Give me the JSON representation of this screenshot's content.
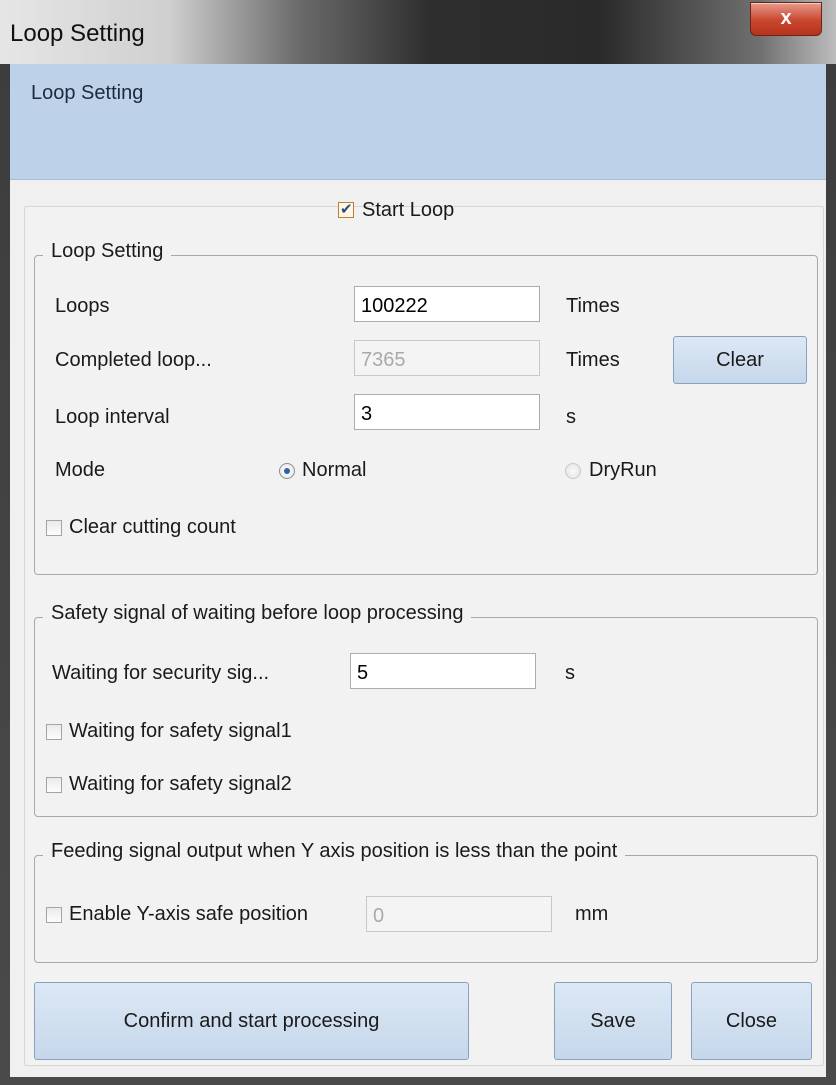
{
  "window": {
    "title": "Loop Setting",
    "close_glyph": "x"
  },
  "header": {
    "title": "Loop Setting"
  },
  "start_loop": {
    "label": "Start Loop",
    "checked": true
  },
  "loop_group": {
    "legend": "Loop Setting",
    "loops_label": "Loops",
    "loops_value": "100222",
    "loops_unit": "Times",
    "completed_label": "Completed  loop...",
    "completed_value": "7365",
    "completed_unit": "Times",
    "clear_button": "Clear",
    "interval_label": "Loop interval",
    "interval_value": "3",
    "interval_unit": "s",
    "mode_label": "Mode",
    "mode_normal": "Normal",
    "mode_dryrun": "DryRun",
    "mode_selected": "Normal",
    "clear_cutting_label": "Clear cutting count",
    "clear_cutting_checked": false
  },
  "safety_group": {
    "legend": "Safety signal of waiting before loop processing",
    "wait_label": "Waiting  for security sig...",
    "wait_value": "5",
    "wait_unit": "s",
    "signal1_label": "Waiting for safety signal1",
    "signal1_checked": false,
    "signal2_label": "Waiting for safety signal2",
    "signal2_checked": false
  },
  "feeding_group": {
    "legend": "Feeding signal output when Y axis position is less than the point",
    "enable_label": "Enable Y-axis safe position",
    "enable_checked": false,
    "position_value": "0",
    "position_unit": "mm"
  },
  "buttons": {
    "confirm": "Confirm and start processing",
    "save": "Save",
    "close": "Close"
  },
  "colors": {
    "header_band": "#bdd1e8",
    "button_face": "#d2e0f0",
    "close_button": "#c9472f"
  }
}
